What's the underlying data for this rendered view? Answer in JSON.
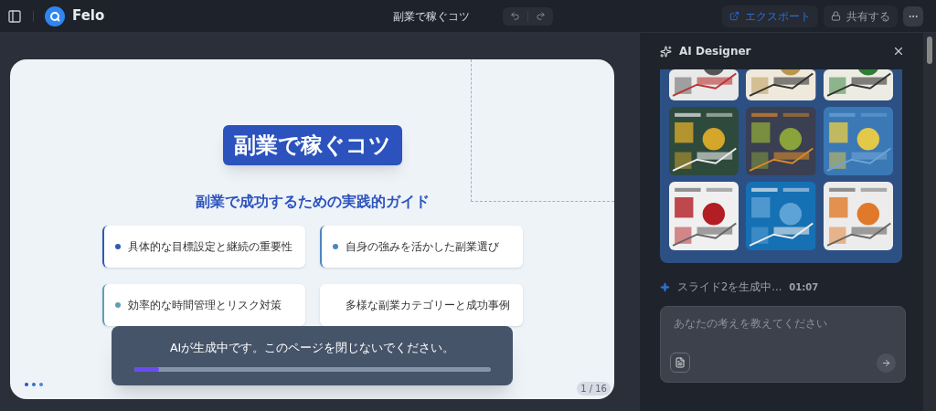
{
  "header": {
    "brand": "Felo",
    "document_title": "副業で稼ぐコツ",
    "actions": [
      {
        "kind": "export",
        "label": "エクスポート"
      },
      {
        "kind": "share",
        "label": "共有する"
      }
    ]
  },
  "slide": {
    "title": "副業で稼ぐコツ",
    "subtitle": "副業で成功するための実践的ガイド",
    "points": [
      {
        "text": "具体的な目標設定と継続の重要性",
        "color": "#2f5bb8"
      },
      {
        "text": "自身の強みを活かした副業選び",
        "color": "#4a86c0"
      },
      {
        "text": "効率的な時間管理とリスク対策",
        "color": "#5f9fb3"
      },
      {
        "text": "多様な副業カテゴリーと成功事例"
      }
    ],
    "page": "1 / 16"
  },
  "progress": {
    "message": "AIが生成中です。このページを閉じないでください。",
    "level": 0.07
  },
  "designer": {
    "title": "AI Designer",
    "status": "スライド2を生成中...",
    "time": "01:07",
    "placeholder": "あなたの考えを教えてください"
  }
}
